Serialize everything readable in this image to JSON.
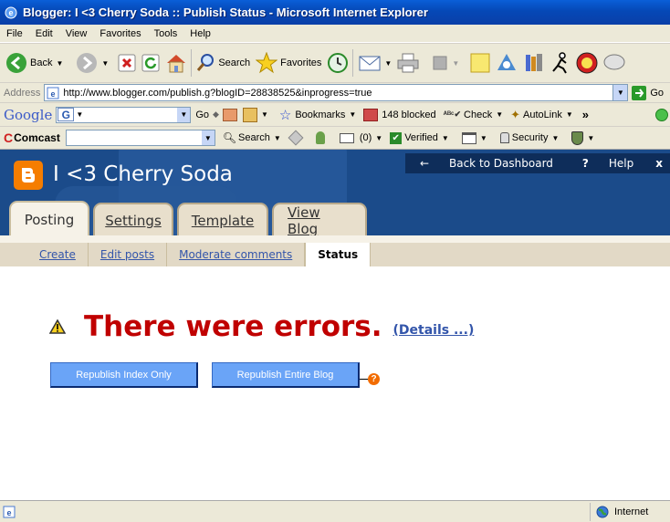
{
  "window": {
    "title": "Blogger: I <3 Cherry Soda :: Publish Status - Microsoft Internet Explorer"
  },
  "menu": [
    "File",
    "Edit",
    "View",
    "Favorites",
    "Tools",
    "Help"
  ],
  "toolbar": {
    "back": "Back",
    "search": "Search",
    "favorites": "Favorites"
  },
  "address": {
    "label": "Address",
    "url": "http://www.blogger.com/publish.g?blogID=28838525&inprogress=true",
    "go": "Go"
  },
  "google_bar": {
    "logo": "Google",
    "go": "Go",
    "bookmarks": "Bookmarks",
    "blocked": "148 blocked",
    "check": "Check",
    "autolink": "AutoLink"
  },
  "comcast_bar": {
    "logo": "Comcast",
    "search": "Search",
    "mail_count": "(0)",
    "verified": "Verified",
    "security": "Security"
  },
  "blog": {
    "title": "I <3 Cherry Soda",
    "back_to_dashboard": "Back to Dashboard",
    "help": "Help",
    "close": "x"
  },
  "tabs": [
    {
      "label": "Posting",
      "active": true
    },
    {
      "label": "Settings",
      "active": false
    },
    {
      "label": "Template",
      "active": false
    },
    {
      "label": "View Blog",
      "active": false
    }
  ],
  "subtabs": [
    {
      "label": "Create",
      "active": false
    },
    {
      "label": "Edit posts",
      "active": false
    },
    {
      "label": "Moderate comments",
      "active": false
    },
    {
      "label": "Status",
      "active": true
    }
  ],
  "status": {
    "error_message": "There were errors.",
    "details_link": "(Details ...)",
    "republish_index": "Republish Index Only",
    "republish_entire": "Republish Entire Blog",
    "help_glyph": "?"
  },
  "statusbar": {
    "zone": "Internet"
  },
  "colors": {
    "error_red": "#c00000",
    "blogger_orange": "#f57d00",
    "header_blue": "#1b4b8a",
    "button_blue": "#6aa4f7",
    "link_blue": "#3355aa"
  }
}
